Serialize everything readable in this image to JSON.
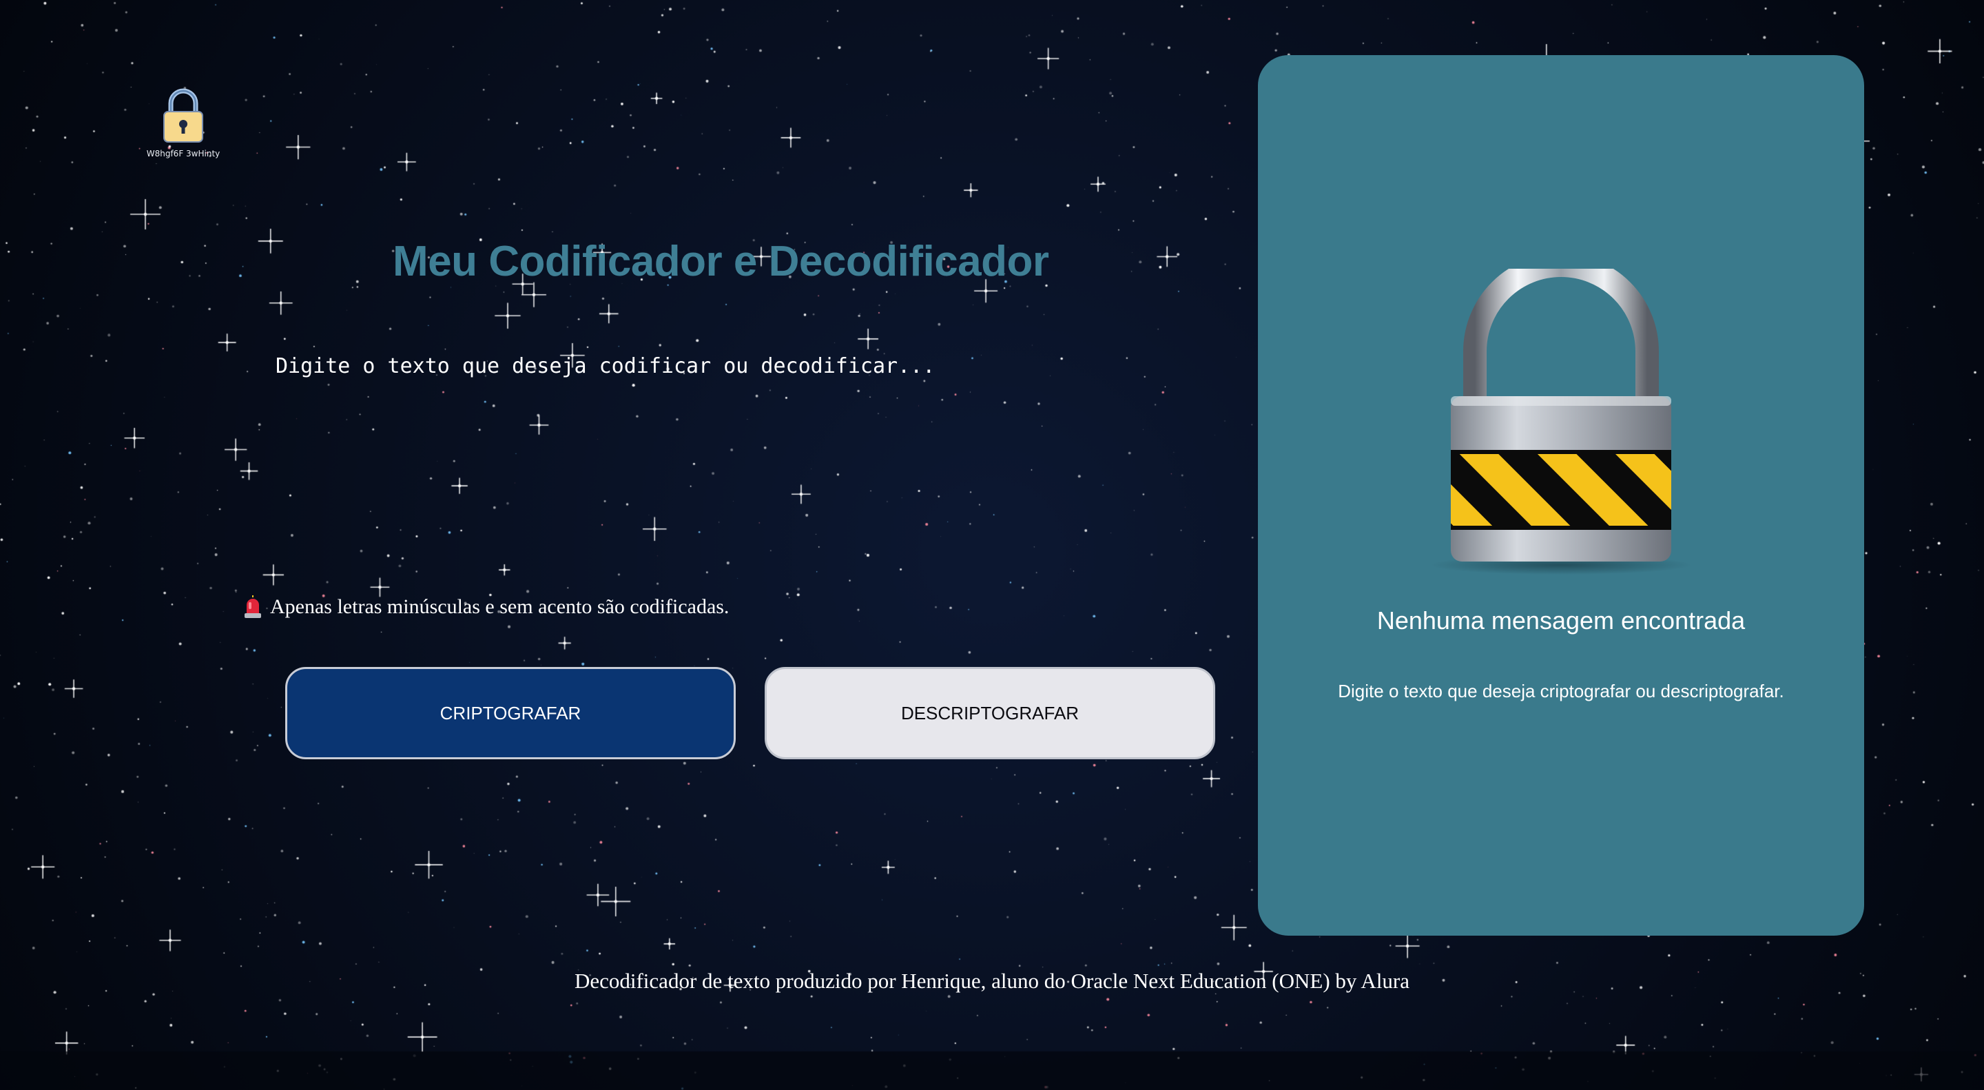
{
  "logo": {
    "caption": "W8hgf6F 3wHinty",
    "icon": "padlock-icon"
  },
  "main": {
    "title": "Meu Codificador e Decodificador",
    "input_placeholder": "Digite o texto que deseja codificar ou decodificar...",
    "input_value": "",
    "warning_icon": "alert-siren-icon",
    "warning_text": "Apenas letras minúsculas e sem acento são codificadas.",
    "encrypt_label": "CRIPTOGRAFAR",
    "decrypt_label": "DESCRIPTOGRAFAR"
  },
  "output_panel": {
    "icon": "padlock-icon",
    "title": "Nenhuma mensagem encontrada",
    "text": "Digite o texto que deseja criptografar ou descriptografar."
  },
  "footer": {
    "credit": "Decodificador de texto produzido por Henrique, aluno do Oracle Next Education (ONE) by Alura"
  },
  "colors": {
    "background": "#03060d",
    "title": "#3f7f95",
    "panel": "#3a7a8c",
    "encrypt_button": "#0a3572",
    "decrypt_button": "#e7e7ec"
  }
}
